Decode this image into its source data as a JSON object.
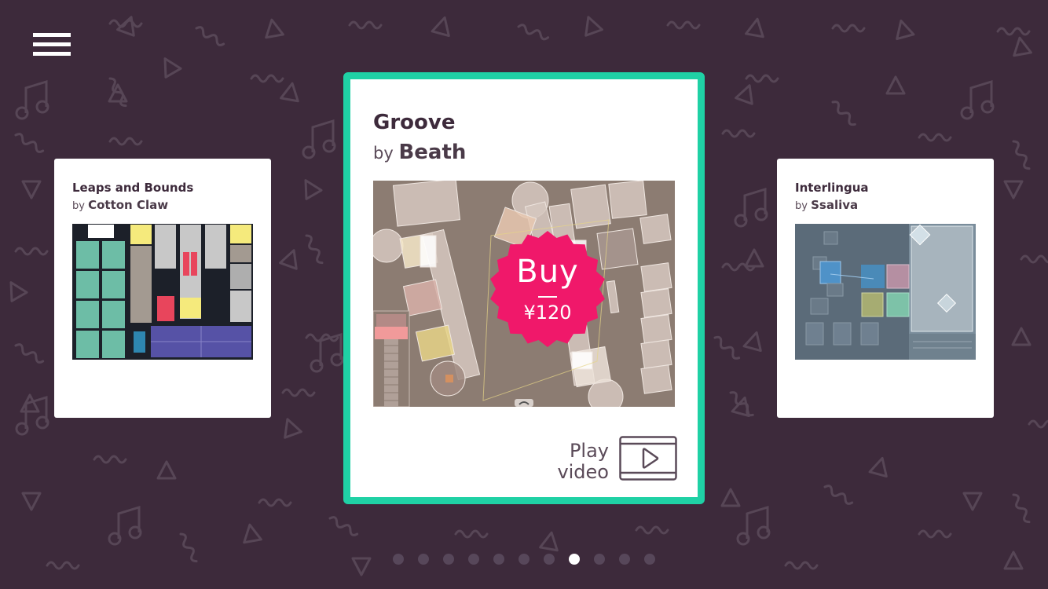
{
  "colors": {
    "background": "#3d2a3b",
    "pattern": "#574656",
    "accent": "#1fd1a5",
    "buy_badge": "#f0186a",
    "card": "#ffffff",
    "title_text": "#3d2a3b"
  },
  "menu": {
    "icon": "hamburger-menu-icon"
  },
  "carousel": {
    "selected_index": 7,
    "page_count": 11,
    "cards": [
      {
        "title": "Leaps and Bounds",
        "by_label": "by",
        "author": "Cotton Claw"
      },
      {
        "title": "Groove",
        "by_label": "by",
        "author": "Beath",
        "buy_label": "Buy",
        "price": "¥120",
        "play_video_line1": "Play",
        "play_video_line2": "video",
        "play_icon": "video-play-icon"
      },
      {
        "title": "Interlingua",
        "by_label": "by",
        "author": "Ssaliva"
      }
    ]
  }
}
